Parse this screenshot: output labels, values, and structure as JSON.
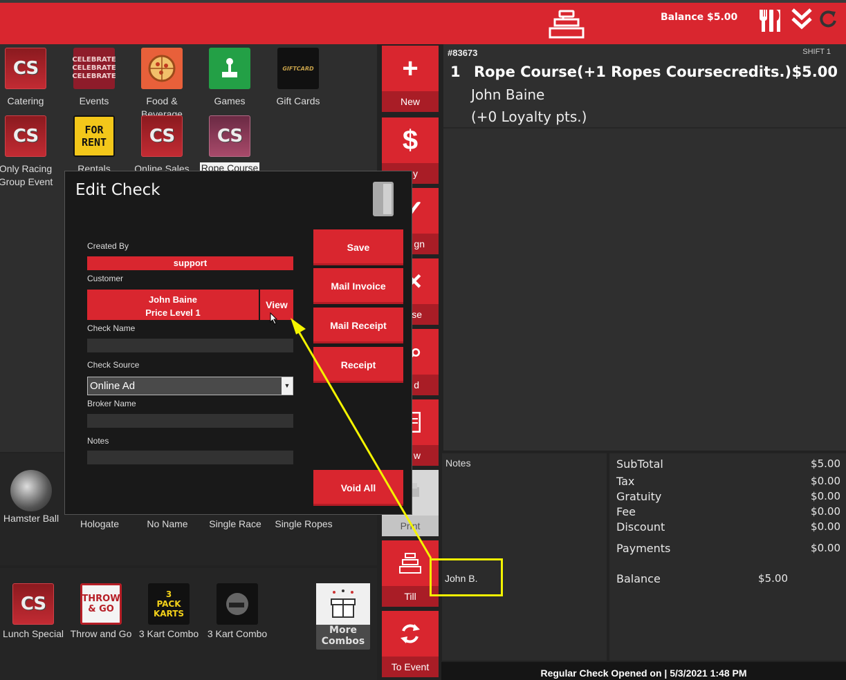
{
  "header": {
    "balance": "Balance $5.00",
    "colors": {
      "accent": "#d9262f",
      "annotation": "#f4f400"
    },
    "icons": [
      "till-icon",
      "utensils-icon",
      "double-chevron-down-icon",
      "refresh-icon"
    ]
  },
  "categories": [
    {
      "label": "Catering",
      "icon": "CS"
    },
    {
      "label": "Events",
      "icon": "CELEBRATE"
    },
    {
      "label": "Food &\nBeverage",
      "icon": "pizza-icon"
    },
    {
      "label": "Games",
      "icon": "joystick-icon"
    },
    {
      "label": "Gift Cards",
      "icon": "GIFTCARD"
    },
    {
      "label": "Only Racing\nGroup Event",
      "icon": "CS"
    },
    {
      "label": "Rentals",
      "icon": "FOR RENT"
    },
    {
      "label": "Online Sales",
      "icon": "CS"
    },
    {
      "label": "Rope Course",
      "icon": "CS"
    }
  ],
  "items_row1": [
    {
      "label": "Hamster Ball"
    },
    {
      "label": "Hologate"
    },
    {
      "label": "No Name"
    },
    {
      "label": "Single Race"
    },
    {
      "label": "Single Ropes"
    }
  ],
  "items_row2": [
    {
      "label": "Lunch Special",
      "icon": "CS"
    },
    {
      "label": "Throw and Go",
      "icon": "THROW\n& GO"
    },
    {
      "label": "3 Kart Combo",
      "icon": "3\nPACK\nKARTS"
    },
    {
      "label": "3 Kart Combo",
      "icon": "helmet-icon"
    },
    {
      "label": "More\nCombos",
      "icon": "gift-box-icon"
    }
  ],
  "actions": {
    "new": "New",
    "pay_partial": "y",
    "assign_partial": "gn",
    "close_partial": "se",
    "find_partial": "d",
    "view_partial": "w",
    "print": "Print",
    "till": "Till",
    "to_event": "To Event"
  },
  "check": {
    "number": "#83673",
    "shift": "SHIFT 1",
    "line_qty": "1",
    "line_item": "Rope Course(+1 Ropes Coursecredits.)",
    "line_amount": "$5.00",
    "customer": "John Baine",
    "loyalty": "(+0 Loyalty pts.)"
  },
  "notes": {
    "label": "Notes",
    "value": "John B."
  },
  "totals": {
    "subtotal_label": "SubTotal",
    "subtotal": "$5.00",
    "tax_label": "Tax",
    "tax": "$0.00",
    "gratuity_label": "Gratuity",
    "gratuity": "$0.00",
    "fee_label": "Fee",
    "fee": "$0.00",
    "discount_label": "Discount",
    "discount": "$0.00",
    "payments_label": "Payments",
    "payments": "$0.00",
    "balance_label": "Balance",
    "balance": "$5.00"
  },
  "footer": "Regular Check Opened on  |  5/3/2021 1:48 PM",
  "modal": {
    "title": "Edit Check",
    "created_by_label": "Created By",
    "created_by": "support",
    "customer_label": "Customer",
    "customer_name": "John Baine",
    "customer_price_level": "Price Level 1",
    "view": "View",
    "check_name_label": "Check Name",
    "check_name": "",
    "check_source_label": "Check Source",
    "check_source": "Online Ad",
    "broker_name_label": "Broker Name",
    "broker_name": "",
    "notes_label": "Notes",
    "notes": "",
    "save": "Save",
    "mail_invoice": "Mail Invoice",
    "mail_receipt": "Mail Receipt",
    "receipt": "Receipt",
    "void_all": "Void All"
  }
}
